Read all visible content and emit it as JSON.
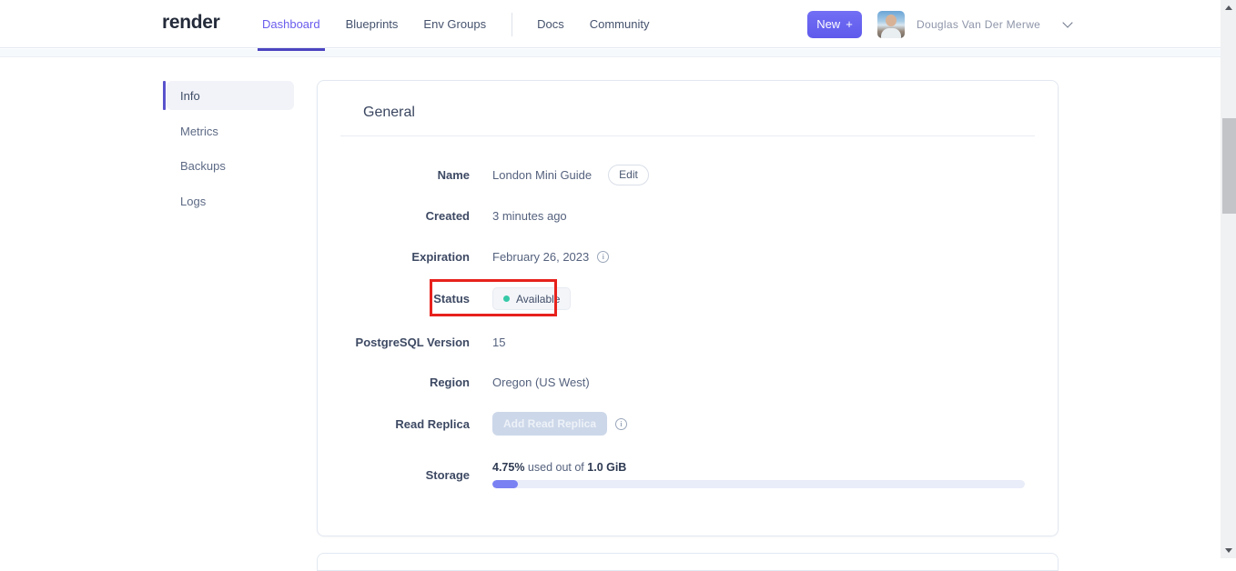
{
  "header": {
    "logo": "render",
    "nav": {
      "dashboard": "Dashboard",
      "blueprints": "Blueprints",
      "env_groups": "Env Groups",
      "docs": "Docs",
      "community": "Community"
    },
    "new_button": {
      "label": "New",
      "plus": "+"
    },
    "user": {
      "name": "Douglas Van Der Merwe"
    }
  },
  "sidebar": {
    "items": [
      {
        "label": "Info",
        "active": true
      },
      {
        "label": "Metrics",
        "active": false
      },
      {
        "label": "Backups",
        "active": false
      },
      {
        "label": "Logs",
        "active": false
      }
    ]
  },
  "general_card": {
    "title": "General",
    "name": {
      "label": "Name",
      "value": "London Mini Guide",
      "edit_button": "Edit"
    },
    "created": {
      "label": "Created",
      "value": "3 minutes ago"
    },
    "expiration": {
      "label": "Expiration",
      "value": "February 26, 2023",
      "info_icon": "i"
    },
    "status": {
      "label": "Status",
      "value": "Available"
    },
    "postgres_version": {
      "label": "PostgreSQL Version",
      "value": "15"
    },
    "region": {
      "label": "Region",
      "value": "Oregon (US West)"
    },
    "read_replica": {
      "label": "Read Replica",
      "button": "Add Read Replica",
      "info_icon": "i"
    },
    "storage": {
      "label": "Storage",
      "used": "4.75%",
      "separator": " used out of ",
      "total": "1.0 GiB",
      "percent_used": 4.75
    }
  },
  "colors": {
    "nav_active": "#6a5ced",
    "brand_button": "#6b66f1",
    "status_dot": "#35c9a8",
    "progress_fill": "#7a81f2",
    "annotation_red": "#e7211c"
  }
}
